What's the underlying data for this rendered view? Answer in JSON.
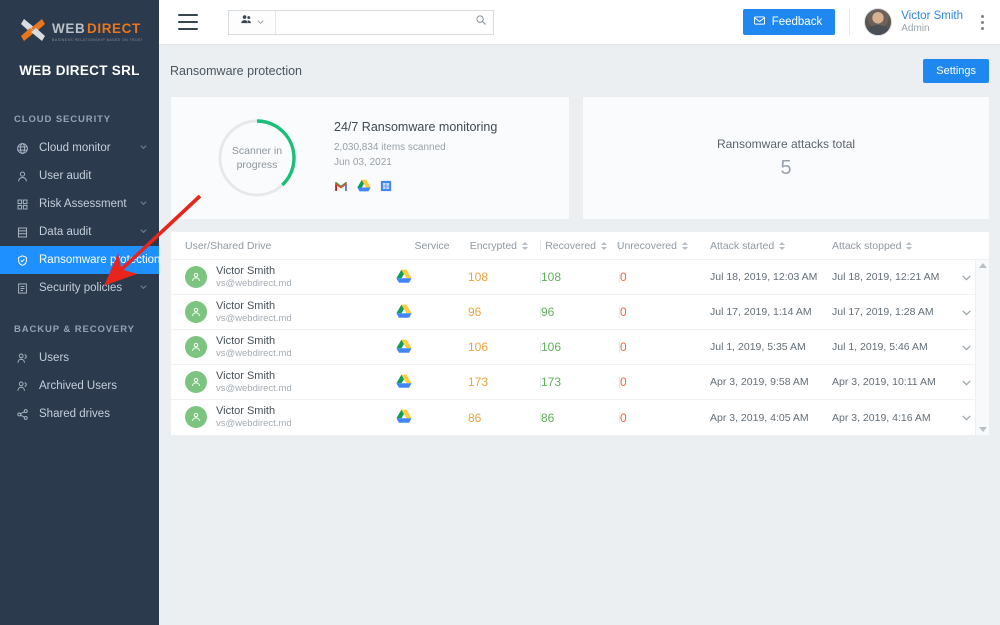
{
  "brand": {
    "logo_word_1": "WEB",
    "logo_word_2": "DIRECT",
    "logo_tagline": "BUSINESS RELATIONSHIP BASED ON TRUST",
    "company": "WEB DIRECT SRL",
    "accent_blue": "#1e88f0",
    "sidebar_bg": "#2b3a4d",
    "logo_orange": "#e8761f"
  },
  "sidebar": {
    "sections": [
      {
        "title": "CLOUD SECURITY",
        "items": [
          {
            "label": "Cloud monitor",
            "icon": "globe-icon",
            "caret": true,
            "active": false
          },
          {
            "label": "User audit",
            "icon": "person-icon",
            "caret": false,
            "active": false
          },
          {
            "label": "Risk Assessment",
            "icon": "grid-icon",
            "caret": true,
            "active": false
          },
          {
            "label": "Data audit",
            "icon": "database-icon",
            "caret": true,
            "active": false
          },
          {
            "label": "Ransomware protection",
            "icon": "shield-check-icon",
            "caret": false,
            "active": true
          },
          {
            "label": "Security policies",
            "icon": "policy-icon",
            "caret": true,
            "active": false
          }
        ]
      },
      {
        "title": "BACKUP & RECOVERY",
        "items": [
          {
            "label": "Users",
            "icon": "users-icon",
            "caret": false,
            "active": false
          },
          {
            "label": "Archived Users",
            "icon": "archived-users-icon",
            "caret": false,
            "active": false
          },
          {
            "label": "Shared drives",
            "icon": "share-icon",
            "caret": false,
            "active": false
          }
        ]
      }
    ]
  },
  "topbar": {
    "menu_icon": "hamburger-icon",
    "search_scope_icon": "people-icon",
    "search_value": "",
    "search_placeholder": "",
    "search_icon": "search-icon",
    "feedback_label": "Feedback",
    "feedback_icon": "envelope-icon",
    "user_name": "Victor Smith",
    "user_role": "Admin",
    "overflow_icon": "kebab-menu-icon"
  },
  "page": {
    "title": "Ransomware protection",
    "settings_label": "Settings"
  },
  "scanner_card": {
    "donut_label_line1": "Scanner in",
    "donut_label_line2": "progress",
    "donut_progress_pct": 38,
    "donut_color": "#17c076",
    "donut_track_color": "#e6e9ec",
    "title": "24/7 Ransomware monitoring",
    "items_scanned": "2,030,834 items scanned",
    "date": "Jun 03, 2021",
    "apps": [
      "gmail-icon",
      "google-drive-icon",
      "google-sheets-icon"
    ]
  },
  "attacks_card": {
    "label": "Ransomware attacks total",
    "value": "5"
  },
  "table": {
    "columns": [
      {
        "label": "User/Shared Drive",
        "sortable": false
      },
      {
        "label": "Service",
        "sortable": false
      },
      {
        "label": "Encrypted",
        "sortable": true
      },
      {
        "label": "Recovered",
        "sortable": true
      },
      {
        "label": "Unrecovered",
        "sortable": true
      },
      {
        "label": "Attack started",
        "sortable": true
      },
      {
        "label": "Attack stopped",
        "sortable": true
      }
    ],
    "rows": [
      {
        "name": "Victor Smith",
        "email": "vs@webdirect.md",
        "service": "google-drive-icon",
        "encrypted": "108",
        "recovered": "108",
        "unrecovered": "0",
        "started": "Jul 18, 2019, 12:03 AM",
        "stopped": "Jul 18, 2019, 12:21 AM"
      },
      {
        "name": "Victor Smith",
        "email": "vs@webdirect.md",
        "service": "google-drive-icon",
        "encrypted": "96",
        "recovered": "96",
        "unrecovered": "0",
        "started": "Jul 17, 2019, 1:14 AM",
        "stopped": "Jul 17, 2019, 1:28 AM"
      },
      {
        "name": "Victor Smith",
        "email": "vs@webdirect.md",
        "service": "google-drive-icon",
        "encrypted": "106",
        "recovered": "106",
        "unrecovered": "0",
        "started": "Jul 1, 2019, 5:35 AM",
        "stopped": "Jul 1, 2019, 5:46 AM"
      },
      {
        "name": "Victor Smith",
        "email": "vs@webdirect.md",
        "service": "google-drive-icon",
        "encrypted": "173",
        "recovered": "173",
        "unrecovered": "0",
        "started": "Apr 3, 2019, 9:58 AM",
        "stopped": "Apr 3, 2019, 10:11 AM"
      },
      {
        "name": "Victor Smith",
        "email": "vs@webdirect.md",
        "service": "google-drive-icon",
        "encrypted": "86",
        "recovered": "86",
        "unrecovered": "0",
        "started": "Apr 3, 2019, 4:05 AM",
        "stopped": "Apr 3, 2019, 4:16 AM"
      }
    ]
  },
  "annotation": {
    "arrow_color": "#e8251c",
    "target": "sidebar-item-ransomware-protection"
  }
}
